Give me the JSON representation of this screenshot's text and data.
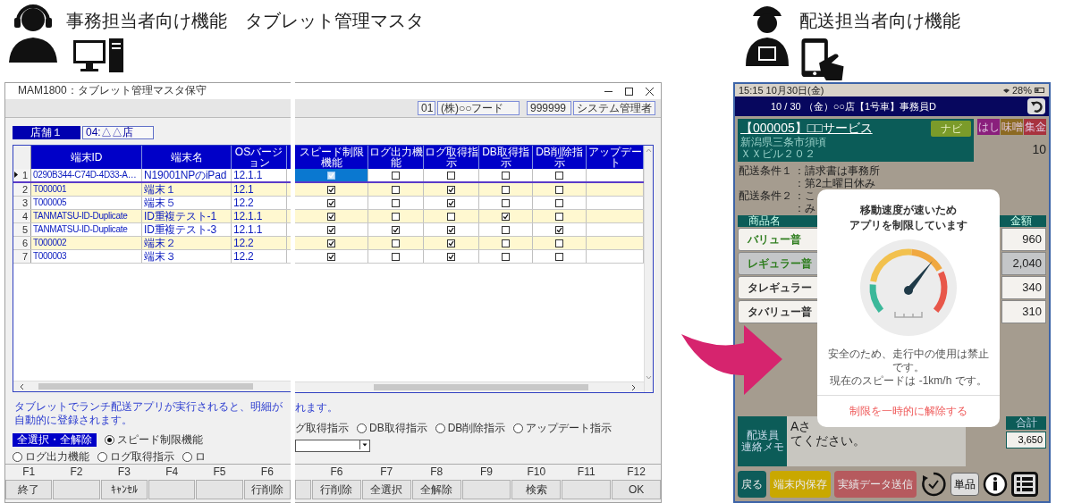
{
  "office_section": {
    "title": "事務担当者向け機能　タブレット管理マスタ"
  },
  "delivery_section": {
    "title": "配送担当者向け機能"
  },
  "window": {
    "title": "MAM1800：タブレット管理マスタ保守",
    "header_fields": [
      "01",
      "(株)○○フード",
      "999999",
      "システム管理者"
    ],
    "store": {
      "label": "店舗１",
      "value": "04:△△店"
    },
    "left_columns": [
      "端末ID",
      "端末名",
      "OSバージョン"
    ],
    "right_columns": [
      "スピード制限機能",
      "ログ出力機能",
      "ログ取得指示",
      "DB取得指示",
      "DB削除指示",
      "アップデート"
    ],
    "rows": [
      {
        "number": "1",
        "id": "0290B344-C74D-4D33-A…",
        "name": "N19001NPのiPad",
        "os": "12.1.1",
        "selected": true,
        "flags": [
          true,
          false,
          false,
          false,
          false
        ]
      },
      {
        "number": "2",
        "id": "T000001",
        "name": "端末１",
        "os": "12.1",
        "selected": false,
        "flags": [
          true,
          false,
          true,
          false,
          false
        ]
      },
      {
        "number": "3",
        "id": "T000005",
        "name": "端末５",
        "os": "12.2",
        "selected": false,
        "flags": [
          true,
          false,
          true,
          false,
          false
        ]
      },
      {
        "number": "4",
        "id": "TANMATSU-ID-Duplicate",
        "name": "ID重複テスト-1",
        "os": "12.1.1",
        "selected": false,
        "flags": [
          true,
          false,
          false,
          true,
          false
        ]
      },
      {
        "number": "5",
        "id": "TANMATSU-ID-Duplicate",
        "name": "ID重複テスト-3",
        "os": "12.1.1",
        "selected": false,
        "flags": [
          true,
          true,
          true,
          false,
          true
        ]
      },
      {
        "number": "6",
        "id": "T000002",
        "name": "端末２",
        "os": "12.2",
        "selected": false,
        "flags": [
          true,
          false,
          true,
          false,
          false
        ]
      },
      {
        "number": "7",
        "id": "T000003",
        "name": "端末３",
        "os": "12.2",
        "selected": false,
        "flags": [
          true,
          false,
          true,
          false,
          false
        ]
      }
    ],
    "message_left": "タブレットでランチ配送アプリが実行されると、明細が自動的に登録されます。",
    "message_right": "れます。",
    "select_all_button": "全選択・全解除",
    "radios_left": [
      {
        "label": "スピード制限機能",
        "selected": true
      },
      {
        "label": "ログ出力機能",
        "selected": false
      },
      {
        "label": "ログ取得指示",
        "selected": false
      },
      {
        "label": "ロ",
        "selected": false
      }
    ],
    "radio_fragment": "グ取得指示",
    "radios_right": [
      {
        "label": "DB取得指示",
        "selected": false
      },
      {
        "label": "DB削除指示",
        "selected": false
      },
      {
        "label": "アップデート指示",
        "selected": false
      }
    ],
    "fkeys_left": [
      {
        "key": "F1",
        "label": "終了"
      },
      {
        "key": "F2"
      },
      {
        "key": "F3",
        "label": "ｷｬﾝｾﾙ"
      },
      {
        "key": "F4"
      },
      {
        "key": "F5"
      },
      {
        "key": "F6",
        "label": "行削除"
      }
    ],
    "fkeys_right": [
      {
        "key": "F6",
        "label": "行削除"
      },
      {
        "key": "F7",
        "label": "全選択"
      },
      {
        "key": "F8",
        "label": "全解除"
      },
      {
        "key": "F9"
      },
      {
        "key": "F10",
        "label": "検索"
      },
      {
        "key": "F11"
      },
      {
        "key": "F12",
        "label": "OK"
      }
    ]
  },
  "tablet": {
    "status_time": "15:15  10月30日(金)",
    "battery": "28%",
    "header": "10 / 30 （金）○○店【1号車】事務員D",
    "customer": {
      "name": "【000005】□□サービス",
      "nav_button": "ナビ",
      "address": [
        "新潟県三条市須頃",
        "ＸＸビル２０２"
      ]
    },
    "tags": [
      {
        "label": "はし",
        "color": "#8a1f7c"
      },
      {
        "label": "味噌",
        "color": "#8c6a22"
      },
      {
        "label": "集金",
        "color": "#a8323e"
      }
    ],
    "count": "10",
    "conditions": [
      {
        "label": "配送条件１",
        "lines": [
          "：請求書は事務所",
          "：第2土曜日休み"
        ]
      },
      {
        "label": "配送条件２",
        "lines": [
          "：こ",
          "：み"
        ]
      }
    ],
    "items_header": {
      "name": "商品名",
      "amount": "金額"
    },
    "items": [
      {
        "name": "バリュー普",
        "amount": "960",
        "featured": true
      },
      {
        "name": "レギュラー普",
        "amount": "2,040",
        "featured": true
      },
      {
        "name": "タレギュラー",
        "amount": "340",
        "featured": false
      },
      {
        "name": "タバリュー普",
        "amount": "310",
        "featured": false
      }
    ],
    "memo": {
      "label": [
        "配送員",
        "連絡メモ"
      ],
      "lines": [
        "Aさ",
        "てください。"
      ]
    },
    "total": {
      "label": "合計",
      "value": "3,650"
    },
    "buttons": [
      {
        "label": "戻る",
        "color": "#0e5c5a"
      },
      {
        "label": "端末内保存",
        "color": "#c9a800"
      },
      {
        "label": "実績データ送信",
        "color": "#b65a5e"
      }
    ],
    "unit_button": "単品",
    "modal": {
      "title": [
        "移動速度が速いため",
        "アプリを制限しています"
      ],
      "message": [
        "安全のため、走行中の使用は禁止です。",
        "現在のスピードは -1km/h です。"
      ],
      "action": "制限を一時的に解除する"
    }
  }
}
